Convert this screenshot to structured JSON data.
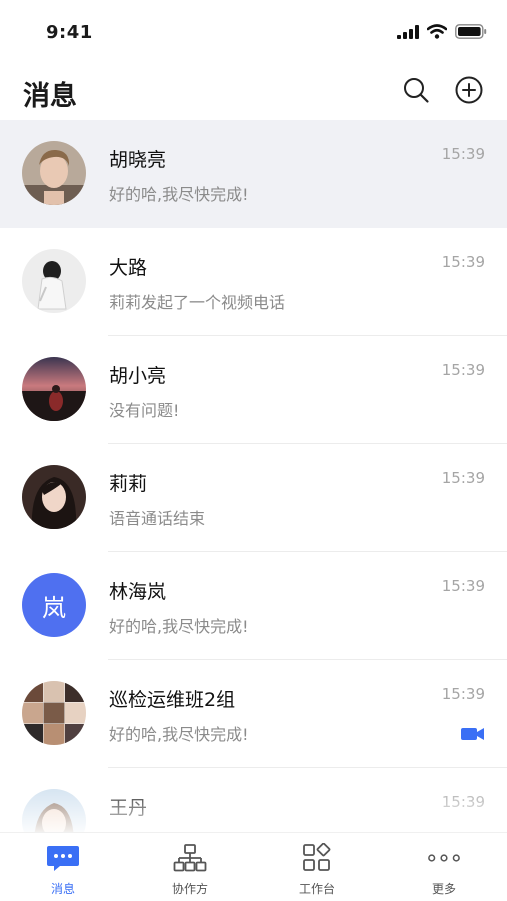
{
  "status": {
    "time": "9:41"
  },
  "header": {
    "title": "消息"
  },
  "chats": [
    {
      "name": "胡晓亮",
      "preview": "好的哈,我尽快完成!",
      "time": "15:39"
    },
    {
      "name": "大路",
      "preview": "莉莉发起了一个视频电话",
      "time": "15:39"
    },
    {
      "name": "胡小亮",
      "preview": "没有问题!",
      "time": "15:39"
    },
    {
      "name": "莉莉",
      "preview": "语音通话结束",
      "time": "15:39"
    },
    {
      "name": "林海岚",
      "preview": "好的哈,我尽快完成!",
      "time": "15:39",
      "avatar_text": "岚"
    },
    {
      "name": "巡检运维班2组",
      "preview": "好的哈,我尽快完成!",
      "time": "15:39",
      "icon": "video-call-icon"
    },
    {
      "name": "王丹",
      "preview": "",
      "time": "15:39"
    }
  ],
  "tabs": [
    {
      "label": "消息",
      "icon": "chat-icon"
    },
    {
      "label": "协作方",
      "icon": "org-chart-icon"
    },
    {
      "label": "工作台",
      "icon": "apps-grid-icon"
    },
    {
      "label": "更多",
      "icon": "more-dots-icon"
    }
  ],
  "colors": {
    "accent": "#3a6ff5",
    "active_row": "#f0f1f5",
    "avatar_blue": "#4f70f0"
  }
}
